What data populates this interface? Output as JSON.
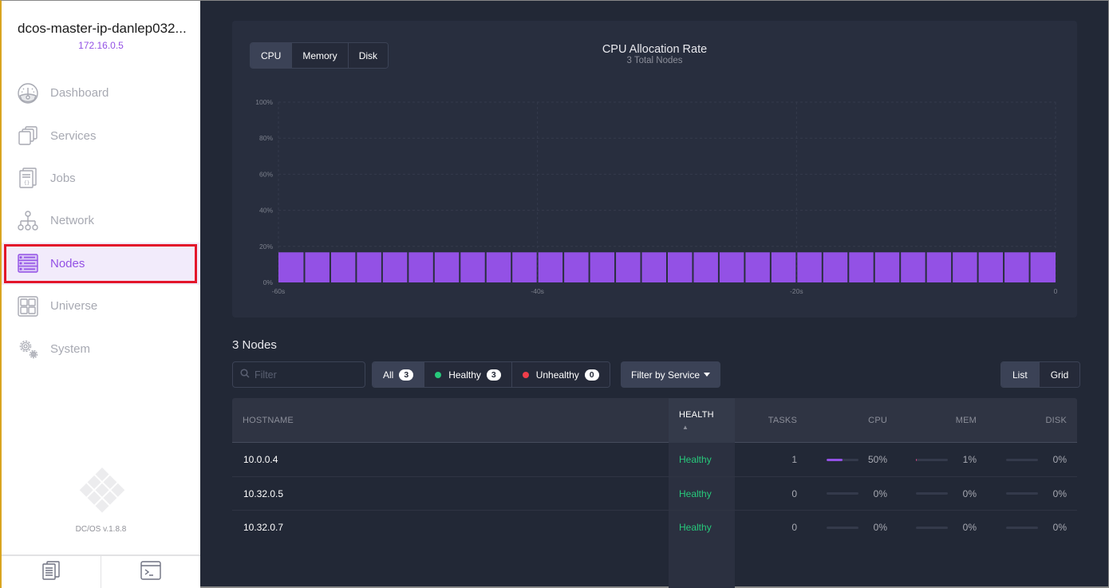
{
  "sidebar": {
    "cluster_name": "dcos-master-ip-danlep032...",
    "cluster_ip": "172.16.0.5",
    "items": [
      {
        "label": "Dashboard",
        "icon": "dashboard-gauge-icon",
        "active": false
      },
      {
        "label": "Services",
        "icon": "services-stack-icon",
        "active": false
      },
      {
        "label": "Jobs",
        "icon": "jobs-document-icon",
        "active": false
      },
      {
        "label": "Network",
        "icon": "network-tree-icon",
        "active": false
      },
      {
        "label": "Nodes",
        "icon": "nodes-server-icon",
        "active": true
      },
      {
        "label": "Universe",
        "icon": "universe-grid-icon",
        "active": false
      },
      {
        "label": "System",
        "icon": "system-gears-icon",
        "active": false
      }
    ],
    "version": "DC/OS v.1.8.8",
    "footer_buttons": [
      {
        "icon": "documentation-icon"
      },
      {
        "icon": "terminal-icon"
      }
    ]
  },
  "chart_panel": {
    "tabs": [
      {
        "label": "CPU",
        "active": true
      },
      {
        "label": "Memory",
        "active": false
      },
      {
        "label": "Disk",
        "active": false
      }
    ]
  },
  "chart_data": {
    "type": "bar",
    "title": "CPU Allocation Rate",
    "subtitle": "3 Total Nodes",
    "xlabel": "",
    "ylabel": "",
    "x_ticks": [
      "-60s",
      "-40s",
      "-20s",
      "0"
    ],
    "y_ticks": [
      "0%",
      "20%",
      "40%",
      "60%",
      "80%",
      "100%"
    ],
    "ylim": [
      0,
      100
    ],
    "xlim": [
      -60,
      0
    ],
    "grid": true,
    "color": "#9351e5",
    "values": [
      16.7,
      16.7,
      16.7,
      16.7,
      16.7,
      16.7,
      16.7,
      16.7,
      16.7,
      16.7,
      16.7,
      16.7,
      16.7,
      16.7,
      16.7,
      16.7,
      16.7,
      16.7,
      16.7,
      16.7,
      16.7,
      16.7,
      16.7,
      16.7,
      16.7,
      16.7,
      16.7,
      16.7,
      16.7,
      16.7
    ]
  },
  "nodes": {
    "title": "3 Nodes",
    "filter_placeholder": "Filter",
    "filter_value": "",
    "health_filters": [
      {
        "label": "All",
        "count": "3",
        "dot_color": null,
        "active": true
      },
      {
        "label": "Healthy",
        "count": "3",
        "dot_color": "#27c97b",
        "active": false
      },
      {
        "label": "Unhealthy",
        "count": "0",
        "dot_color": "#f03e4a",
        "active": false
      }
    ],
    "service_filter_label": "Filter by Service",
    "view_toggle": [
      {
        "label": "List",
        "active": true
      },
      {
        "label": "Grid",
        "active": false
      }
    ],
    "columns": {
      "hostname": "HOSTNAME",
      "health": "HEALTH",
      "tasks": "TASKS",
      "cpu": "CPU",
      "mem": "MEM",
      "disk": "DISK"
    },
    "sort_indicator": "▲",
    "rows": [
      {
        "hostname": "10.0.0.4",
        "health": "Healthy",
        "tasks": "1",
        "cpu": "50%",
        "cpu_value": 50,
        "mem": "1%",
        "mem_value": 1,
        "disk": "0%",
        "disk_value": 0
      },
      {
        "hostname": "10.32.0.5",
        "health": "Healthy",
        "tasks": "0",
        "cpu": "0%",
        "cpu_value": 0,
        "mem": "0%",
        "mem_value": 0,
        "disk": "0%",
        "disk_value": 0
      },
      {
        "hostname": "10.32.0.7",
        "health": "Healthy",
        "tasks": "0",
        "cpu": "0%",
        "cpu_value": 0,
        "mem": "0%",
        "mem_value": 0,
        "disk": "0%",
        "disk_value": 0
      }
    ],
    "colors": {
      "healthy": "#27c97b",
      "cpu_bar": "#9351e5",
      "mem_bar": "#e5468a",
      "disk_bar": "#9351e5"
    }
  }
}
